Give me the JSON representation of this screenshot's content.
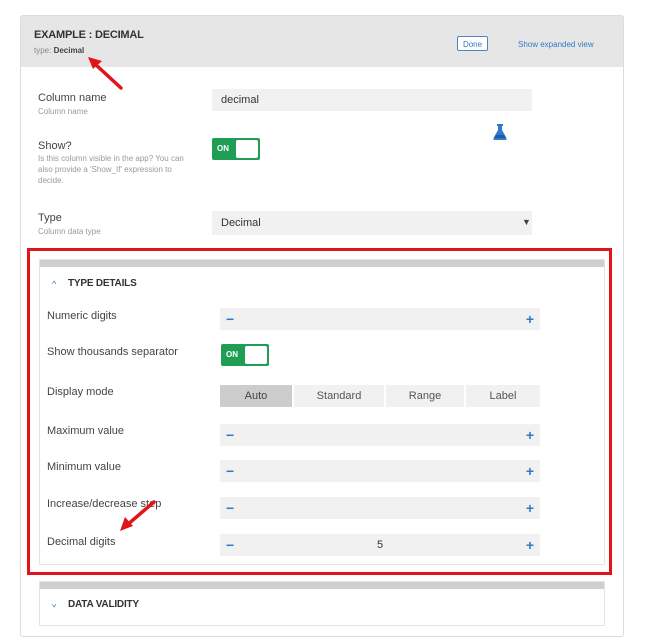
{
  "header": {
    "title": "EXAMPLE : DECIMAL",
    "type_prefix": "type:",
    "type_value": "Decimal",
    "done_label": "Done",
    "expand_label": "Show expanded view"
  },
  "column_name": {
    "label": "Column name",
    "sublabel": "Column name",
    "value": "decimal"
  },
  "show": {
    "label": "Show?",
    "sublabel_1": "Is this column visible in the app? You can",
    "sublabel_2": "also provide a 'Show_If' expression to",
    "sublabel_3": "decide.",
    "toggle_label": "ON",
    "toggle_on": true
  },
  "type": {
    "label": "Type",
    "sublabel": "Column data type",
    "value": "Decimal"
  },
  "type_details": {
    "title": "TYPE DETAILS",
    "numeric_digits_label": "Numeric digits",
    "thousands_label": "Show thousands separator",
    "thousands_toggle": "ON",
    "display_mode_label": "Display mode",
    "display_modes": [
      "Auto",
      "Standard",
      "Range",
      "Label"
    ],
    "display_mode_selected": "Auto",
    "max_label": "Maximum value",
    "min_label": "Minimum value",
    "step_label": "Increase/decrease step",
    "decimal_digits_label": "Decimal digits",
    "decimal_digits_value": "5",
    "minus": "−",
    "plus": "+"
  },
  "data_validity": {
    "title": "DATA VALIDITY"
  },
  "colors": {
    "toggle_green": "#1f9d55",
    "accent_blue": "#2f7ac9",
    "highlight_red": "#e0141a"
  }
}
